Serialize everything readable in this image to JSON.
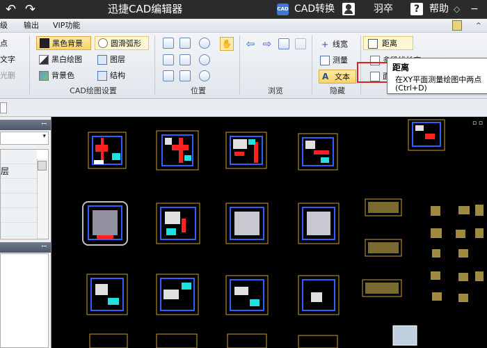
{
  "titlebar": {
    "undo_icon": "undo-arrow-icon",
    "redo_icon": "redo-arrow-icon",
    "title": "迅捷CAD编辑器",
    "cad_logo": "CAD",
    "cad_convert": "CAD转换",
    "username": "羽卒",
    "help_glyph": "?",
    "help": "帮助",
    "pin_glyph": "◇",
    "minimize_glyph": "−"
  },
  "menubar": {
    "items": [
      "级",
      "输出",
      "VIP功能"
    ],
    "right_arrow": "^"
  },
  "ribbon": {
    "left_cut": {
      "r1": "点",
      "r2": "文字",
      "r3": "光删"
    },
    "cad_group": {
      "black_bg": "黑色背景",
      "smooth_arc": "圆滑弧形",
      "bw_drawing": "黑白绘图",
      "layers": "图层",
      "bg_color": "背景色",
      "structure": "结构",
      "label": "CAD绘图设置"
    },
    "position_group": {
      "label": "位置",
      "hand": "✋"
    },
    "browse_group": {
      "label": "浏览"
    },
    "hide_group": {
      "line_width": "线宽",
      "measure": "测量",
      "text": "文本",
      "label": "隐藏"
    },
    "measure_group": {
      "distance": "距离",
      "polyline_length": "多段线长度",
      "area_partial": "面"
    }
  },
  "tooltip": {
    "title": "距离",
    "description": "在XY平面测量绘图中两点",
    "shortcut": "(Ctrl+D)"
  },
  "leftpanel": {
    "pin_glyph": "ꟷ",
    "layer_label": "层",
    "dropdown_arrow": "▾"
  },
  "canvas": {
    "view_buttons": "▫ ▫"
  }
}
